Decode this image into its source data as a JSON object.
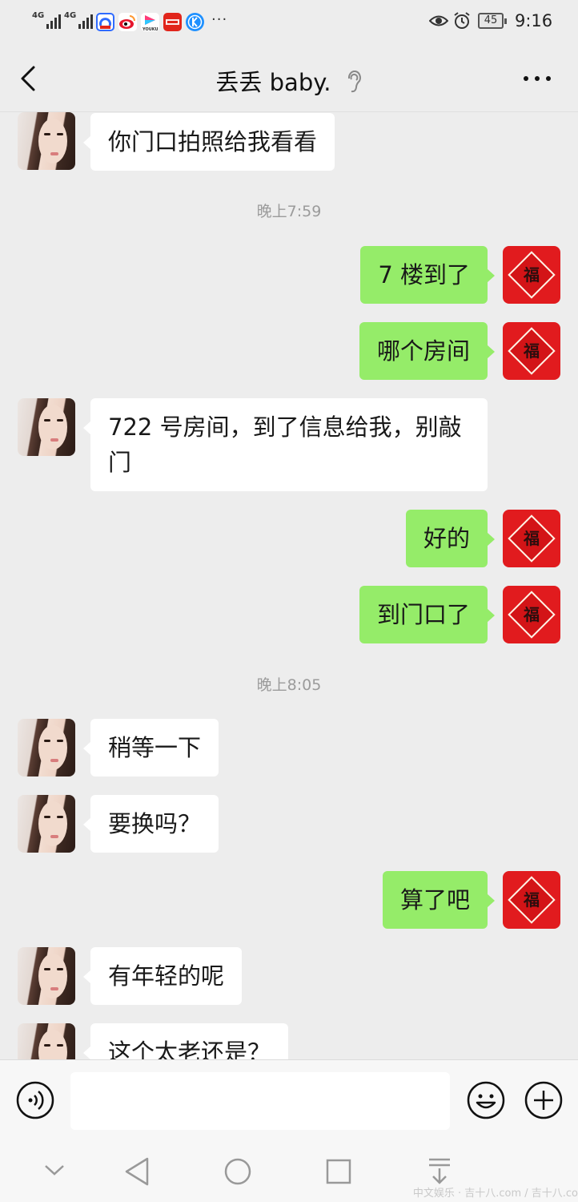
{
  "status_bar": {
    "network_1": "4G",
    "network_2": "4G",
    "app_icons": [
      {
        "name": "baidu-app-icon",
        "color": "#2f6bff"
      },
      {
        "name": "weibo-app-icon",
        "color": "#ffcc00"
      },
      {
        "name": "youku-app-icon",
        "color": "#ff3a78"
      },
      {
        "name": "jingdong-app-icon",
        "color": "#e1251b"
      },
      {
        "name": "kugou-app-icon",
        "color": "#1e90ff"
      }
    ],
    "overflow": "···",
    "battery": "45",
    "time": "9:16"
  },
  "header": {
    "title": "丢丢 baby.",
    "back_icon": "chevron-left-icon",
    "ear_icon": "ear-icon",
    "more_icon": "more-dots-icon"
  },
  "messages": [
    {
      "side": "left",
      "text": "你门口拍照给我看看"
    },
    {
      "type": "time",
      "text": "晚上7:59"
    },
    {
      "side": "right",
      "text": "7 楼到了"
    },
    {
      "side": "right",
      "text": "哪个房间"
    },
    {
      "side": "left",
      "text": "722 号房间，到了信息给我，别敲门"
    },
    {
      "side": "right",
      "text": "好的"
    },
    {
      "side": "right",
      "text": "到门口了"
    },
    {
      "type": "time",
      "text": "晚上8:05"
    },
    {
      "side": "left",
      "text": "稍等一下"
    },
    {
      "side": "left",
      "text": "要换吗？"
    },
    {
      "side": "right",
      "text": "算了吧"
    },
    {
      "side": "left",
      "text": "有年轻的呢"
    },
    {
      "side": "left",
      "text": "这个太老还是？"
    }
  ],
  "avatars": {
    "contact": "contact-avatar",
    "self_glyph": "福",
    "self_color": "#e11b1e"
  },
  "input_bar": {
    "value": "",
    "voice_icon": "voice-icon",
    "emoji_icon": "emoji-icon",
    "plus_icon": "plus-icon"
  },
  "nav_bar": {
    "icons": [
      "nav-hide-icon",
      "nav-back-icon",
      "nav-home-icon",
      "nav-recents-icon",
      "nav-notification-icon"
    ]
  },
  "watermark": "中文娱乐 · 吉十八.com / 吉十八.co"
}
